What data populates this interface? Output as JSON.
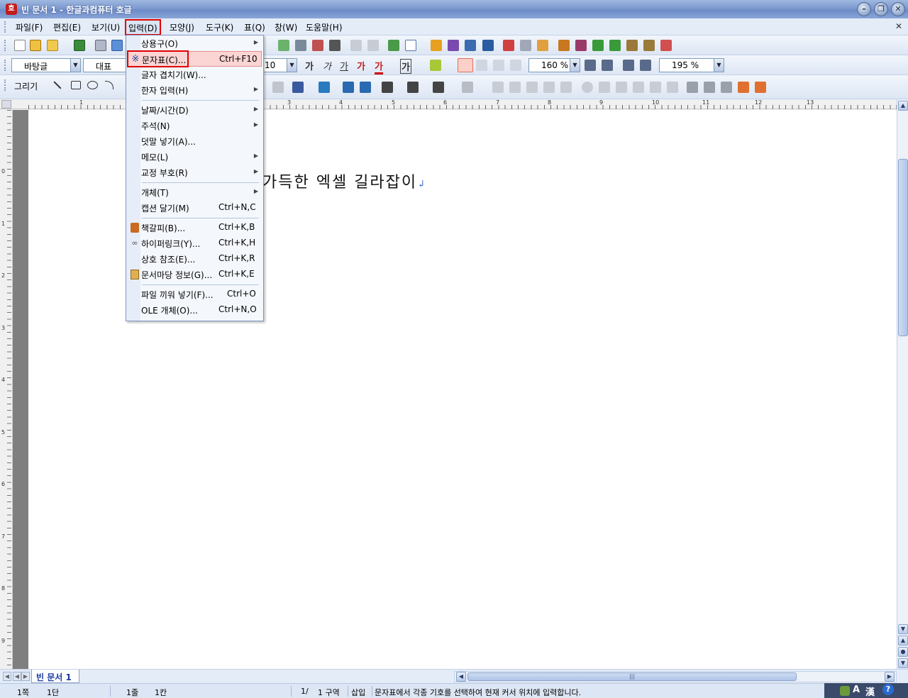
{
  "window": {
    "title": "빈 문서 1 - 한글과컴퓨터 호글",
    "app_icon": "호",
    "buttons": {
      "minimize": "–",
      "restore": "❐",
      "close": "✕"
    }
  },
  "menubar": {
    "items": [
      "파일(F)",
      "편집(E)",
      "보기(U)",
      "입력(D)",
      "모양(J)",
      "도구(K)",
      "표(Q)",
      "창(W)",
      "도움말(H)"
    ],
    "active_index": 3,
    "close_glyph": "✕"
  },
  "format_toolbar": {
    "style": "바탕글",
    "font_group": "대표",
    "font_size": "10",
    "line_spacing": "160 %",
    "zoom": "195 %",
    "char_glyphs": [
      "가",
      "가",
      "가",
      "가",
      "가",
      "가"
    ]
  },
  "draw_toolbar": {
    "label": "그리기"
  },
  "ruler": {
    "numbers": [
      "1",
      "2",
      "3",
      "4",
      "5",
      "6",
      "7",
      "8",
      "9",
      "10",
      "11",
      "12",
      "13"
    ],
    "v_numbers": [
      "0",
      "1",
      "2",
      "3",
      "4",
      "5",
      "6",
      "7",
      "8",
      "9"
    ]
  },
  "document": {
    "text": "가득한 엑셀 길라잡이",
    "paragraph_mark": "↲"
  },
  "insert_menu": {
    "items": [
      {
        "label": "상용구(O)",
        "shortcut": "",
        "submenu": true,
        "icon": ""
      },
      {
        "label": "문자표(C)...",
        "shortcut": "Ctrl+F10",
        "submenu": false,
        "icon": "※"
      },
      {
        "label": "글자 겹치기(W)...",
        "shortcut": "",
        "submenu": false,
        "icon": ""
      },
      {
        "label": "한자 입력(H)",
        "shortcut": "",
        "submenu": true,
        "icon": ""
      },
      {
        "label": "날짜/시간(D)",
        "shortcut": "",
        "submenu": true,
        "icon": ""
      },
      {
        "label": "주석(N)",
        "shortcut": "",
        "submenu": true,
        "icon": ""
      },
      {
        "label": "덧말 넣기(A)...",
        "shortcut": "",
        "submenu": false,
        "icon": ""
      },
      {
        "label": "메모(L)",
        "shortcut": "",
        "submenu": true,
        "icon": ""
      },
      {
        "label": "교정 부호(R)",
        "shortcut": "",
        "submenu": true,
        "icon": ""
      },
      {
        "label": "개체(T)",
        "shortcut": "",
        "submenu": true,
        "icon": ""
      },
      {
        "label": "캡션 달기(M)",
        "shortcut": "Ctrl+N,C",
        "submenu": false,
        "icon": ""
      },
      {
        "label": "책갈피(B)...",
        "shortcut": "Ctrl+K,B",
        "submenu": false,
        "icon": "bookmark"
      },
      {
        "label": "하이퍼링크(Y)...",
        "shortcut": "Ctrl+K,H",
        "submenu": false,
        "icon": "link"
      },
      {
        "label": "상호 참조(E)...",
        "shortcut": "Ctrl+K,R",
        "submenu": false,
        "icon": ""
      },
      {
        "label": "문서마당 정보(G)...",
        "shortcut": "Ctrl+K,E",
        "submenu": false,
        "icon": "doc-info"
      },
      {
        "label": "파일 끼워 넣기(F)...",
        "shortcut": "Ctrl+O",
        "submenu": false,
        "icon": ""
      },
      {
        "label": "OLE 개체(O)...",
        "shortcut": "Ctrl+N,O",
        "submenu": false,
        "icon": ""
      }
    ],
    "highlight_index": 1
  },
  "bottombar": {
    "doc_tab": "빈 문서 1"
  },
  "statusbar": {
    "page": "1쪽",
    "column": "1단",
    "line": "1줄",
    "char": "1칸",
    "page_count": "1/",
    "section": "1 구역",
    "mode": "삽입",
    "message": "문자표에서 각종 기호를 선택하여 현재 커서 위치에 입력합니다."
  },
  "ime": {
    "a": "A",
    "hanja": "漢",
    "help": "?"
  },
  "colors": {
    "highlight_red": "#e00000",
    "menu_highlight": "#fbd4d4",
    "titlebar": "#7d9ad0"
  }
}
